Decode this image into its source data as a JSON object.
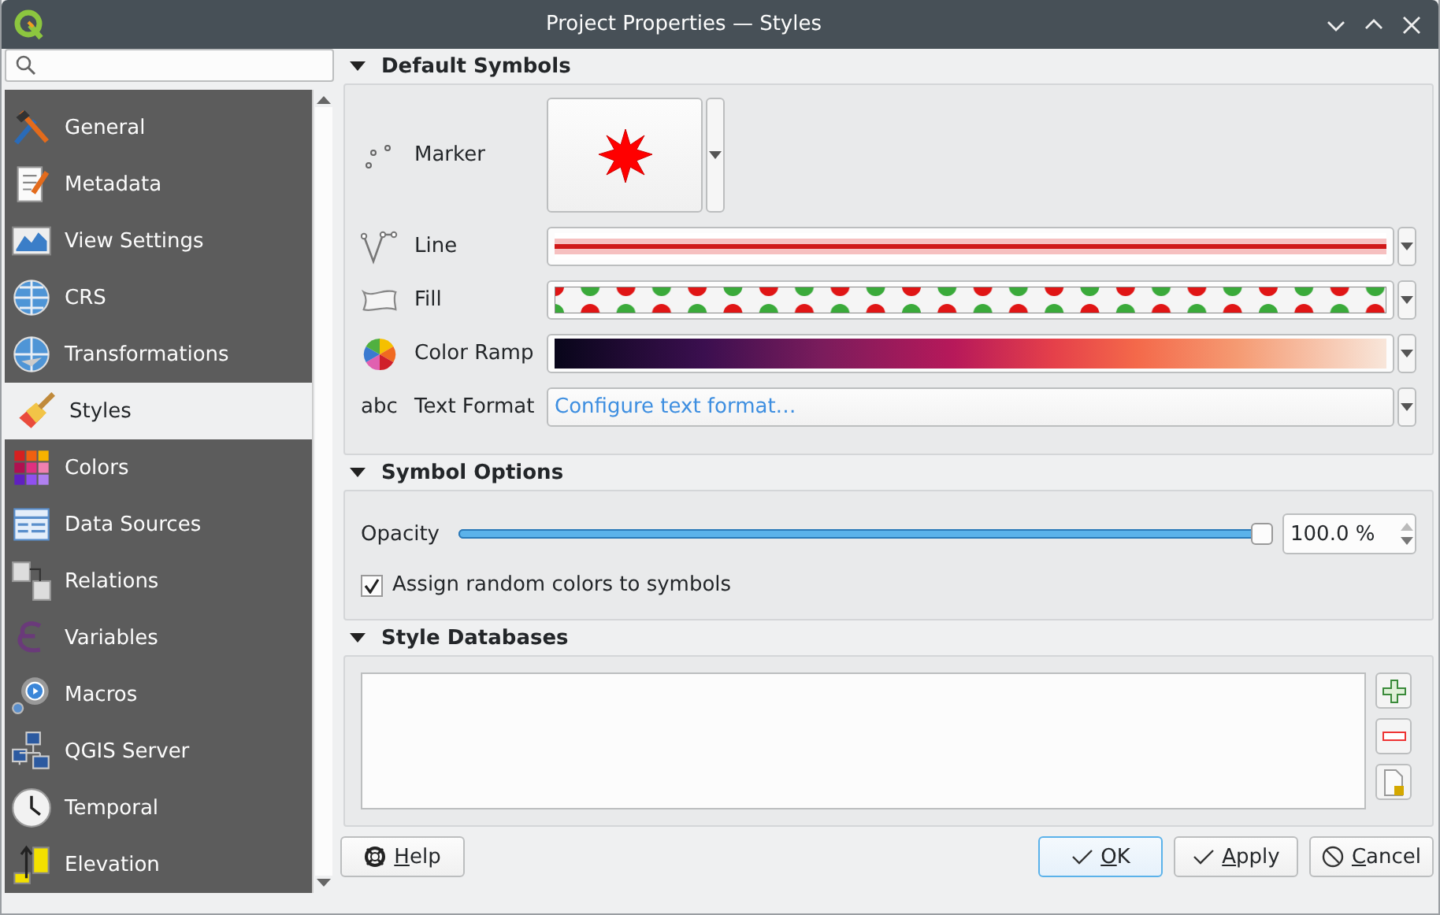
{
  "window": {
    "title": "Project Properties — Styles"
  },
  "sidebar": {
    "items": [
      {
        "label": "General",
        "selected": false
      },
      {
        "label": "Metadata",
        "selected": false
      },
      {
        "label": "View Settings",
        "selected": false
      },
      {
        "label": "CRS",
        "selected": false
      },
      {
        "label": "Transformations",
        "selected": false
      },
      {
        "label": "Styles",
        "selected": true
      },
      {
        "label": "Colors",
        "selected": false
      },
      {
        "label": "Data Sources",
        "selected": false
      },
      {
        "label": "Relations",
        "selected": false
      },
      {
        "label": "Variables",
        "selected": false
      },
      {
        "label": "Macros",
        "selected": false
      },
      {
        "label": "QGIS Server",
        "selected": false
      },
      {
        "label": "Temporal",
        "selected": false
      },
      {
        "label": "Elevation",
        "selected": false
      }
    ]
  },
  "default_symbols": {
    "title": "Default Symbols",
    "expanded": true,
    "rows": [
      {
        "kind": "marker",
        "label": "Marker"
      },
      {
        "kind": "line",
        "label": "Line"
      },
      {
        "kind": "fill",
        "label": "Fill"
      },
      {
        "kind": "ramp",
        "label": "Color Ramp"
      },
      {
        "kind": "text",
        "label": "Text Format",
        "icon_text": "abc",
        "value": "Configure text format…"
      }
    ]
  },
  "symbol_options": {
    "title": "Symbol Options",
    "expanded": true,
    "opacity": {
      "label": "Opacity",
      "level": 1.0,
      "reading": "100.0 %"
    },
    "random_colors": {
      "label": "Assign random colors to symbols",
      "checked": true
    }
  },
  "style_databases": {
    "title": "Style Databases",
    "expanded": true
  },
  "buttons": [
    {
      "kind": "help",
      "label": "Help",
      "default": false
    },
    {
      "kind": "ok",
      "label": "OK",
      "default": true
    },
    {
      "kind": "apply",
      "label": "Apply",
      "default": false
    },
    {
      "kind": "cancel",
      "label": "Cancel",
      "default": false
    }
  ]
}
